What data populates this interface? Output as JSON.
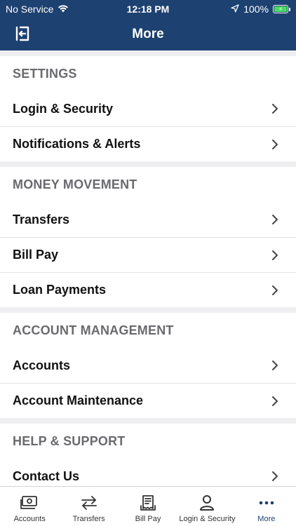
{
  "status_bar": {
    "carrier": "No Service",
    "time": "12:18 PM",
    "battery": "100%"
  },
  "header": {
    "title": "More"
  },
  "sections": [
    {
      "title": "SETTINGS",
      "items": [
        {
          "label": "Login & Security"
        },
        {
          "label": "Notifications & Alerts"
        }
      ]
    },
    {
      "title": "MONEY MOVEMENT",
      "items": [
        {
          "label": "Transfers"
        },
        {
          "label": "Bill Pay"
        },
        {
          "label": "Loan Payments"
        }
      ]
    },
    {
      "title": "ACCOUNT MANAGEMENT",
      "items": [
        {
          "label": "Accounts"
        },
        {
          "label": "Account Maintenance"
        }
      ]
    },
    {
      "title": "HELP & SUPPORT",
      "items": [
        {
          "label": "Contact Us"
        }
      ]
    }
  ],
  "tab_bar": {
    "items": [
      {
        "label": "Accounts",
        "icon": "accounts-icon"
      },
      {
        "label": "Transfers",
        "icon": "transfers-icon"
      },
      {
        "label": "Bill Pay",
        "icon": "bill-pay-icon"
      },
      {
        "label": "Login & Security",
        "icon": "person-icon"
      },
      {
        "label": "More",
        "icon": "more-icon"
      }
    ],
    "active": "More"
  },
  "colors": {
    "header_bg": "#1d4170",
    "accent": "#1d4170",
    "battery": "#4cd964"
  }
}
